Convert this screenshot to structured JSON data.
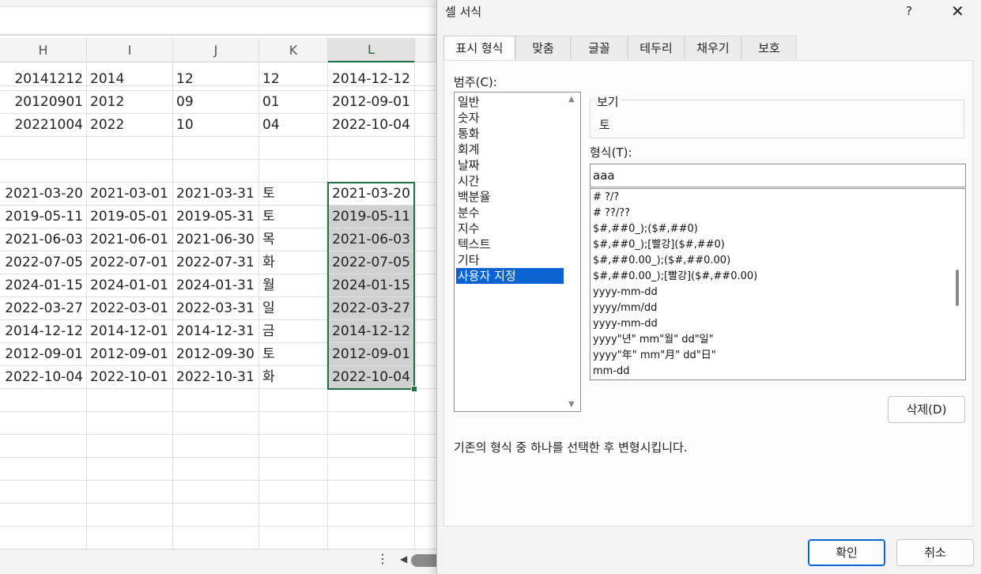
{
  "sheet": {
    "columns": [
      "H",
      "I",
      "J",
      "K",
      "L"
    ],
    "selected_column": "L",
    "rows_top": [
      [
        "20141212",
        "2014",
        "12",
        "12",
        "2014-12-12"
      ],
      [
        "20120901",
        "2012",
        "09",
        "01",
        "2012-09-01"
      ],
      [
        "20221004",
        "2022",
        "10",
        "04",
        "2022-10-04"
      ]
    ],
    "rows_main": [
      [
        "2021-03-20",
        "2021-03-01",
        "2021-03-31",
        "토",
        "2021-03-20"
      ],
      [
        "2019-05-11",
        "2019-05-01",
        "2019-05-31",
        "토",
        "2019-05-11"
      ],
      [
        "2021-06-03",
        "2021-06-01",
        "2021-06-30",
        "목",
        "2021-06-03"
      ],
      [
        "2022-07-05",
        "2022-07-01",
        "2022-07-31",
        "화",
        "2022-07-05"
      ],
      [
        "2024-01-15",
        "2024-01-01",
        "2024-01-31",
        "월",
        "2024-01-15"
      ],
      [
        "2022-03-27",
        "2022-03-01",
        "2022-03-31",
        "일",
        "2022-03-27"
      ],
      [
        "2014-12-12",
        "2014-12-01",
        "2014-12-31",
        "금",
        "2014-12-12"
      ],
      [
        "2012-09-01",
        "2012-09-01",
        "2012-09-30",
        "토",
        "2012-09-01"
      ],
      [
        "2022-10-04",
        "2022-10-01",
        "2022-10-31",
        "화",
        "2022-10-04"
      ]
    ],
    "more_icon": "⋮",
    "scroll_left_icon": "◀"
  },
  "dialog": {
    "title": "셀 서식",
    "help_label": "?",
    "close_label": "✕",
    "tabs": [
      "표시 형식",
      "맞춤",
      "글꼴",
      "테두리",
      "채우기",
      "보호"
    ],
    "active_tab": "표시 형식",
    "category_label": "범주(C):",
    "categories": [
      "일반",
      "숫자",
      "통화",
      "회계",
      "날짜",
      "시간",
      "백분율",
      "분수",
      "지수",
      "텍스트",
      "기타",
      "사용자 지정"
    ],
    "selected_category": "사용자 지정",
    "preview_label": "보기",
    "preview_value": "토",
    "format_label": "형식(T):",
    "format_value": "aaa",
    "format_list": [
      "# ?/?",
      "# ??/??",
      "$#,##0_);($#,##0)",
      "$#,##0_);[빨강]($#,##0)",
      "$#,##0.00_);($#,##0.00)",
      "$#,##0.00_);[빨강]($#,##0.00)",
      "yyyy-mm-dd",
      "yyyy/mm/dd",
      "yyyy-mm-dd",
      "yyyy\"년\" mm\"월\" dd\"일\"",
      "yyyy\"年\" mm\"月\" dd\"日\"",
      "mm-dd"
    ],
    "delete_button": "삭제(D)",
    "hint": "기존의 형식 중 하나를 선택한 후 변형시킵니다.",
    "ok_button": "확인",
    "cancel_button": "취소"
  }
}
